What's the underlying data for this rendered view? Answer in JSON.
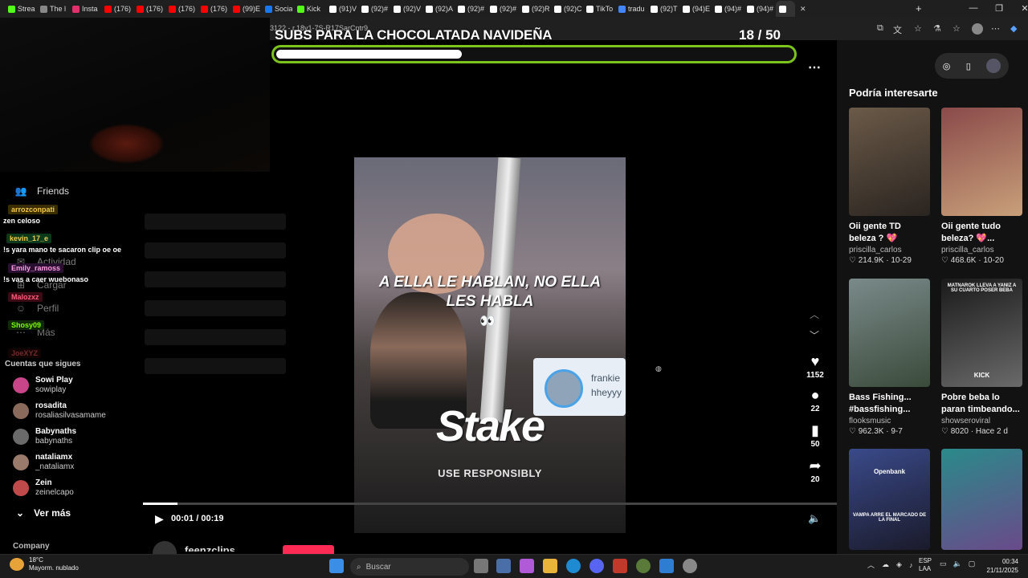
{
  "browser": {
    "tabs": [
      {
        "label": "Strea",
        "color": "#53fc18"
      },
      {
        "label": "The l",
        "color": "#888888"
      },
      {
        "label": "Insta",
        "color": "#e1306c"
      },
      {
        "label": "(176)",
        "color": "#ff0000"
      },
      {
        "label": "(176)",
        "color": "#ff0000"
      },
      {
        "label": "(176)",
        "color": "#ff0000"
      },
      {
        "label": "(176)",
        "color": "#ff0000"
      },
      {
        "label": "(99)E",
        "color": "#ff0000"
      },
      {
        "label": "Socia",
        "color": "#1877f2"
      },
      {
        "label": "Kick",
        "color": "#53fc18"
      },
      {
        "label": "(91)V",
        "color": "#ffffff"
      },
      {
        "label": "(92)#",
        "color": "#ffffff"
      },
      {
        "label": "(92)V",
        "color": "#ffffff"
      },
      {
        "label": "(92)A",
        "color": "#ffffff"
      },
      {
        "label": "(92)#",
        "color": "#ffffff"
      },
      {
        "label": "(92)#",
        "color": "#ffffff"
      },
      {
        "label": "(92)R",
        "color": "#ffffff"
      },
      {
        "label": "(92)C",
        "color": "#ffffff"
      },
      {
        "label": "TikTo",
        "color": "#ffffff"
      },
      {
        "label": "tradu",
        "color": "#4285f4"
      },
      {
        "label": "(92)T",
        "color": "#ffffff"
      },
      {
        "label": "(94)E",
        "color": "#ffffff"
      },
      {
        "label": "(94)#",
        "color": "#ffffff"
      },
      {
        "label": "(94)#",
        "color": "#ffffff"
      },
      {
        "label": "",
        "color": "#ffffff"
      }
    ],
    "url_fragment": "3122 - r.18y1-7S-R17SarCntr9"
  },
  "overlay": {
    "goal_title": "SUBS PARA LA CHOCOLATADA NAVIDEÑA",
    "goal_current": "18",
    "goal_sep": "/ 50",
    "goal_progress": 0.36,
    "goal_color": "#7cc41c"
  },
  "sidebar": {
    "nav": [
      {
        "label": "Friends",
        "icon": "friends-icon"
      },
      {
        "label": "Actividad",
        "icon": "activity-icon"
      },
      {
        "label": "Cargar",
        "icon": "upload-icon"
      },
      {
        "label": "Perfil",
        "icon": "profile-icon"
      },
      {
        "label": "Más",
        "icon": "more-icon"
      }
    ],
    "chat": [
      {
        "user": "arrozconpati",
        "msg": "zen celoso",
        "color": "#f2c94c",
        "badge_bg": "#3a2d00"
      },
      {
        "user": "kevin_17_e",
        "msg": "!s yara mano te sacaron clip oe oe",
        "color": "#f2c94c",
        "badge_bg": "#0b3a1a"
      },
      {
        "user": "Emily_ramoss",
        "msg": "!s vas a caer wuebonaso",
        "color": "#ff9ee6",
        "badge_bg": "#2a1030"
      },
      {
        "user": "Malozxz",
        "msg": "",
        "color": "#ff5c7a",
        "badge_bg": "#3a0b14"
      },
      {
        "user": "Shosy09",
        "msg": "",
        "color": "#7cfc00",
        "badge_bg": "#102a08"
      },
      {
        "user": "JoeXYZ",
        "msg": "",
        "color": "#ff5c5c",
        "badge_bg": "#2a0a0a"
      }
    ],
    "following_header": "Cuentas que sigues",
    "following": [
      {
        "name": "Sowi Play",
        "handle": "sowiplay",
        "color": "#c9458a"
      },
      {
        "name": "rosadita",
        "handle": "rosaliasilvasamame",
        "color": "#8a6a5a"
      },
      {
        "name": "Babynaths",
        "handle": "babynaths",
        "color": "#6a6a6a"
      },
      {
        "name": "nataliamx",
        "handle": "_nataliamx",
        "color": "#9a7a6a"
      },
      {
        "name": "Zein",
        "handle": "zeinelcapo",
        "color": "#c04a4a"
      }
    ],
    "see_more": "Ver más",
    "company": "Company"
  },
  "video": {
    "caption_line1": "A ELLA LE HABLAN, NO ELLA",
    "caption_line2": "LES HABLA",
    "eyes": "👀",
    "dm_name": "frankie",
    "dm_text": "hheyyy",
    "brand": "Stake",
    "brand_sub": "USE RESPONSIBLY",
    "time_current": "00:01",
    "time_sep": "/",
    "time_total": "00:19",
    "progress": 0.05,
    "author": "feenzclips"
  },
  "actions": {
    "likes": "1152",
    "comments": "22",
    "saves": "50",
    "shares": "20"
  },
  "recommendations": {
    "title": "Podría interesarte",
    "cards": [
      {
        "title": "Oii gente TD beleza ? 💖#priscilla_carlos",
        "author": "priscilla_carlos",
        "stats": "♡ 214.9K · 10-29",
        "bg1": "#6b5a48",
        "bg2": "#2a2420"
      },
      {
        "title": "Oii gente tudo beleza? 💖...",
        "author": "priscilla_carlos",
        "stats": "♡ 468.6K · 10-20",
        "bg1": "#8a4a4a",
        "bg2": "#c9a07a"
      },
      {
        "title": "Bass Fishing... #bassfishing...",
        "author": "flooksmusic",
        "stats": "♡ 962.3K · 9-7",
        "bg1": "#7a8a8a",
        "bg2": "#3a4a3a"
      },
      {
        "title": "Pobre beba lo paran timbeando...",
        "author": "showseroviral",
        "stats": "♡ 8020 · Hace 2 d",
        "bg1": "#1a1a1a",
        "bg2": "#6a6a6a",
        "overlay_text": "MATNAROK LLEVA A YANIZ A SU CUARTO POSER BEBA",
        "overlay_tag": "KICK"
      },
      {
        "title": "",
        "author": "",
        "stats": "",
        "bg1": "#3a4a8a",
        "bg2": "#1a1a2a",
        "overlay_text": "VAMPA ARRE EL MARCADO DE LA FINAL",
        "overlay_tag": "Openbank"
      },
      {
        "title": "",
        "author": "",
        "stats": "",
        "bg1": "#2a8a8a",
        "bg2": "#6a4a8a",
        "overlay_text": "",
        "overlay_tag": ""
      }
    ]
  },
  "taskbar": {
    "weather_temp": "18°C",
    "weather_desc": "Mayorm. nublado",
    "search_placeholder": "Buscar",
    "lang1": "ESP",
    "lang2": "LAA",
    "time": "00:34",
    "date": "21/11/2025"
  }
}
